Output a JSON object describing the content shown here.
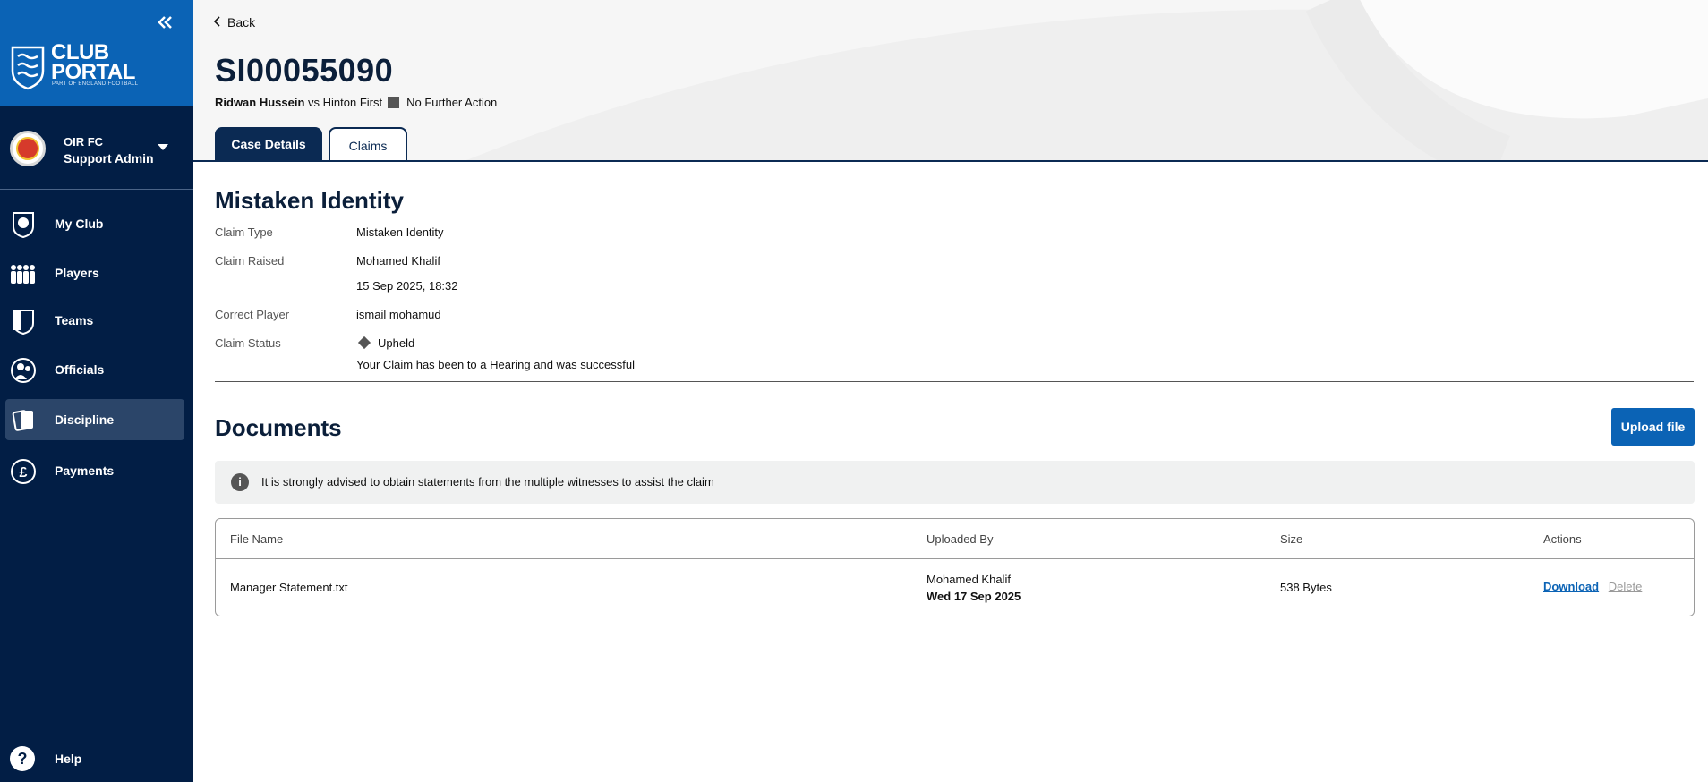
{
  "sidebar": {
    "brand_line1": "CLUB",
    "brand_line2": "PORTAL",
    "brand_sub": "PART OF ENGLAND FOOTBALL",
    "collapse_icon": "double-chevron-left-icon",
    "club": {
      "name": "OIR FC",
      "role": "Support Admin"
    },
    "items": [
      {
        "label": "My Club",
        "icon": "shield-ball-icon"
      },
      {
        "label": "Players",
        "icon": "players-icon"
      },
      {
        "label": "Teams",
        "icon": "team-shirt-icon"
      },
      {
        "label": "Officials",
        "icon": "whistle-icon"
      },
      {
        "label": "Discipline",
        "icon": "cards-icon",
        "active": true
      },
      {
        "label": "Payments",
        "icon": "pound-icon"
      }
    ],
    "help_label": "Help"
  },
  "header": {
    "back_label": "Back",
    "case_id": "SI00055090",
    "player": "Ridwan Hussein",
    "fixture": "vs Hinton First",
    "outcome": "No Further Action",
    "tabs": [
      {
        "label": "Case Details",
        "active": false
      },
      {
        "label": "Claims",
        "active": true
      }
    ]
  },
  "claim": {
    "title": "Mistaken Identity",
    "type_label": "Claim Type",
    "type_value": "Mistaken Identity",
    "raised_label": "Claim Raised",
    "raised_by": "Mohamed Khalif",
    "raised_date": "15 Sep 2025, 18:32",
    "correct_player_label": "Correct Player",
    "correct_player_value": "ismail mohamud",
    "status_label": "Claim Status",
    "status_value": "Upheld",
    "status_note": "Your Claim has been to a Hearing and was successful"
  },
  "documents": {
    "title": "Documents",
    "upload_label": "Upload file",
    "notice": "It is strongly advised to obtain statements from the multiple witnesses to assist the claim",
    "columns": [
      "File Name",
      "Uploaded By",
      "Size",
      "Actions"
    ],
    "rows": [
      {
        "file_name": "Manager Statement.txt",
        "uploaded_by": "Mohamed Khalif",
        "uploaded_date": "Wed 17 Sep 2025",
        "size": "538 Bytes",
        "download_label": "Download",
        "delete_label": "Delete"
      }
    ]
  },
  "colors": {
    "sidebar_bg": "#021e45",
    "brand_bg": "#0b63b5",
    "accent": "#0b63b5",
    "active_nav": "#2b4569"
  }
}
